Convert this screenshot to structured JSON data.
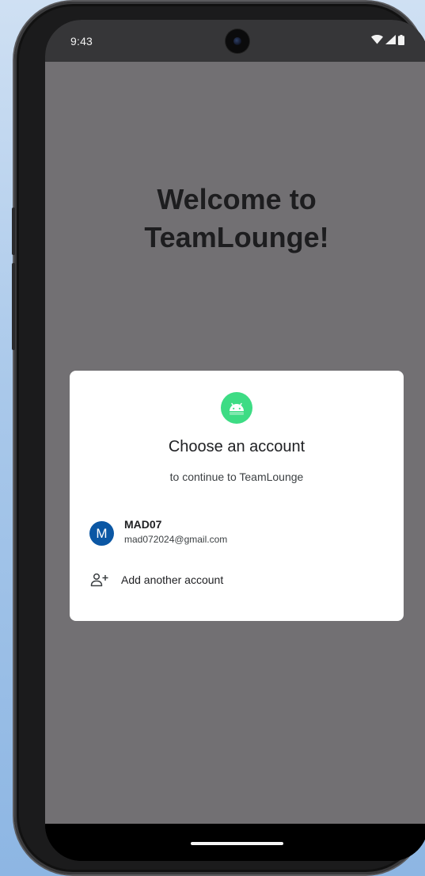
{
  "status_bar": {
    "time": "9:43",
    "icons": [
      "wifi-icon",
      "cellular-signal-icon",
      "battery-icon"
    ]
  },
  "app": {
    "welcome_line1": "Welcome to",
    "welcome_line2": "TeamLounge!"
  },
  "dialog": {
    "app_icon": "android-icon",
    "title": "Choose an account",
    "subtitle": "to continue to TeamLounge",
    "accounts": [
      {
        "avatar_letter": "M",
        "name": "MAD07",
        "email": "mad072024@gmail.com"
      }
    ],
    "add_account_icon": "add-person-icon",
    "add_account_label": "Add another account"
  },
  "colors": {
    "page_background": "#a9c8ea",
    "scrim": "#727073",
    "status_bar": "#363638",
    "avatar": "#0b57a4",
    "android_green": "#3ddc84"
  }
}
